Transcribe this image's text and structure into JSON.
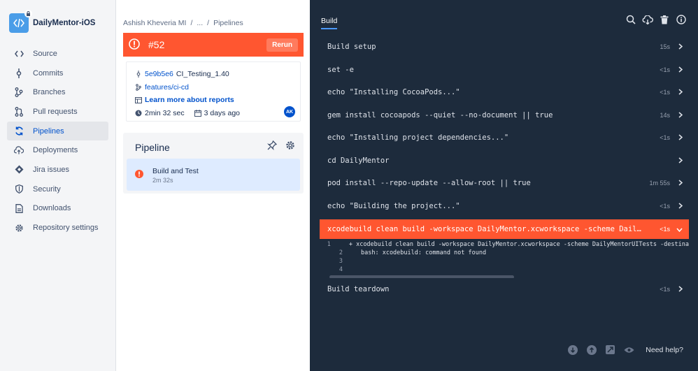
{
  "repo": {
    "name": "DailyMentor-iOS"
  },
  "sidebar": {
    "items": [
      {
        "label": "Source",
        "icon": "code-icon"
      },
      {
        "label": "Commits",
        "icon": "commit-icon"
      },
      {
        "label": "Branches",
        "icon": "branch-icon"
      },
      {
        "label": "Pull requests",
        "icon": "pull-request-icon"
      },
      {
        "label": "Pipelines",
        "icon": "pipelines-icon",
        "active": true
      },
      {
        "label": "Deployments",
        "icon": "cloud-upload-icon"
      },
      {
        "label": "Jira issues",
        "icon": "jira-icon"
      },
      {
        "label": "Security",
        "icon": "shield-icon"
      },
      {
        "label": "Downloads",
        "icon": "file-icon"
      },
      {
        "label": "Repository settings",
        "icon": "gear-icon"
      }
    ]
  },
  "breadcrumb": {
    "owner": "Ashish Kheveria MI",
    "sep": "/",
    "ellipsis": "...",
    "current": "Pipelines"
  },
  "run": {
    "number": "#52",
    "rerun_label": "Rerun",
    "commit": "5e9b5e6",
    "commit_message": "CI_Testing_1.40",
    "branch": "features/ci-cd",
    "reports_link": "Learn more about reports",
    "duration": "2min 32 sec",
    "age": "3 days ago",
    "author_initials": "AK",
    "colors": {
      "failed": "#ff5630",
      "accent": "#0052cc"
    }
  },
  "pipeline": {
    "title": "Pipeline",
    "step": {
      "name": "Build and Test",
      "duration": "2m 32s"
    }
  },
  "log": {
    "tab": "Build",
    "rows_before": [
      {
        "cmd": "Build setup",
        "time": "15s"
      },
      {
        "cmd": "set -e",
        "time": "<1s"
      },
      {
        "cmd": "echo \"Installing CocoaPods...\"",
        "time": "<1s"
      },
      {
        "cmd": "gem install cocoapods --quiet --no-document || true",
        "time": "14s"
      },
      {
        "cmd": "echo \"Installing project dependencies...\"",
        "time": "<1s"
      },
      {
        "cmd": "cd DailyMentor",
        "time": ""
      },
      {
        "cmd": "pod install --repo-update --allow-root || true",
        "time": "1m 55s"
      },
      {
        "cmd": "echo \"Building the project...\"",
        "time": "<1s"
      }
    ],
    "failed_row": {
      "cmd": "xcodebuild clean build -workspace DailyMentor.xcworkspace -scheme DailyMento…",
      "time": "<1s"
    },
    "output": [
      {
        "n": "1",
        "text": "+ xcodebuild clean build -workspace DailyMentor.xcworkspace -scheme DailyMentorUITests -destina"
      },
      {
        "n": "2",
        "text": "bash: xcodebuild: command not found"
      },
      {
        "n": "3",
        "text": ""
      },
      {
        "n": "4",
        "text": ""
      }
    ],
    "rows_after": [
      {
        "cmd": "Build teardown",
        "time": "<1s"
      }
    ],
    "help": "Need help?"
  }
}
